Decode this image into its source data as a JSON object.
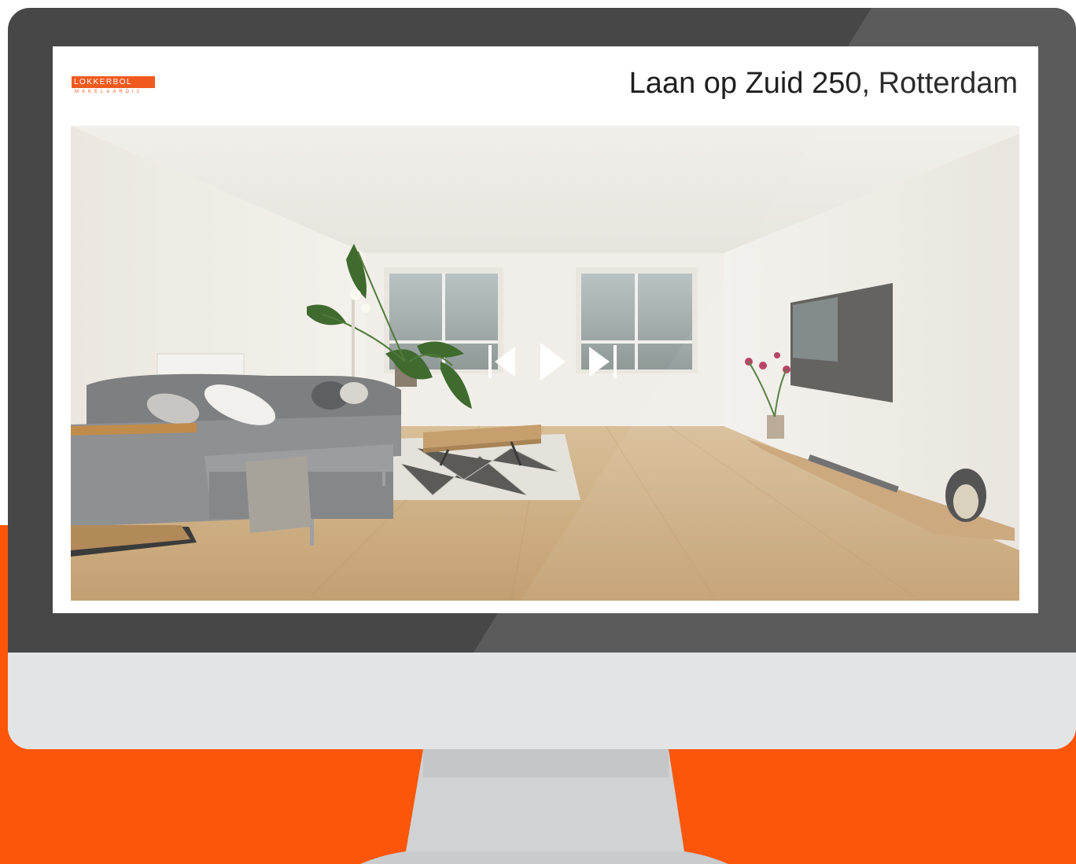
{
  "header": {
    "logo_name": "LOKKERBOL",
    "logo_tagline": "MAKELAARDIJ",
    "address": "Laan op Zuid 250, Rotterdam"
  },
  "player": {
    "prev_icon": "skip-previous-icon",
    "play_icon": "play-icon",
    "next_icon": "skip-next-icon"
  },
  "colors": {
    "brand_orange": "#fb560a",
    "bezel": "#474747",
    "chin": "#e3e4e6"
  }
}
